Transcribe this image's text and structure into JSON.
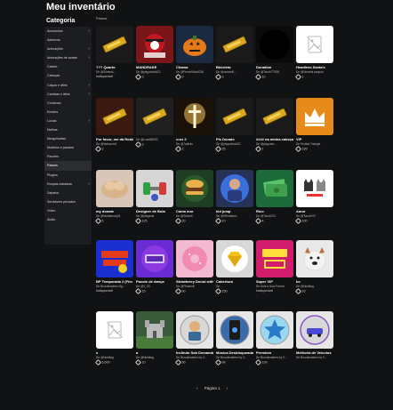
{
  "page": {
    "title": "Meu inventário",
    "category_title": "Categoria",
    "section_label": "Passes",
    "pagination": {
      "prev": "‹",
      "label": "Página 1",
      "next": "›"
    }
  },
  "sidebar": {
    "items": [
      {
        "label": "Acessórios",
        "chevron": true
      },
      {
        "label": "Adesivos",
        "chevron": false
      },
      {
        "label": "Animações",
        "chevron": true
      },
      {
        "label": "Animações de avatar",
        "chevron": true
      },
      {
        "label": "Cabelo",
        "chevron": false
      },
      {
        "label": "Cabeças",
        "chevron": false
      },
      {
        "label": "Calças e afins",
        "chevron": true
      },
      {
        "label": "Camisas e afins",
        "chevron": true
      },
      {
        "label": "Conteúdo",
        "chevron": false
      },
      {
        "label": "Emotes",
        "chevron": false
      },
      {
        "label": "Locais",
        "chevron": true
      },
      {
        "label": "Malhas",
        "chevron": false
      },
      {
        "label": "Mergulhadas",
        "chevron": false
      },
      {
        "label": "Modelos e pacotes",
        "chevron": false
      },
      {
        "label": "Pacotes",
        "chevron": false
      },
      {
        "label": "Passes",
        "chevron": false,
        "active": true
      },
      {
        "label": "Plugins",
        "chevron": false
      },
      {
        "label": "Roupas clássicas",
        "chevron": true
      },
      {
        "label": "Sapatos",
        "chevron": false
      },
      {
        "label": "Servidores privados",
        "chevron": false
      },
      {
        "label": "Vídeo",
        "chevron": false
      },
      {
        "label": "Áudio",
        "chevron": false
      }
    ]
  },
  "items": [
    {
      "name": "??? Quarto",
      "creator": "De @Slimesit...",
      "price": "Indisponível",
      "icon": "gold-bar-icon",
      "bg": "#1a1a1a"
    },
    {
      "name": "MANDRAKE",
      "creator": "De @pisguetodd23",
      "price": "3",
      "icon": "skull-flag-icon",
      "bg": "#7a1518"
    },
    {
      "name": "Chama",
      "creator": "De @FerrariVida2026",
      "price": "9",
      "icon": "pumpkin-icon",
      "bg": "#1b2a40"
    },
    {
      "name": "Bicicleta",
      "creator": "De @zacarelli...",
      "price": "3",
      "icon": "gold-bar-icon",
      "bg": "#1a1a1a"
    },
    {
      "name": "Donation",
      "creator": "De @Tocob779D8",
      "price": "10",
      "icon": "black-circle-icon",
      "bg": "#0a0a0a"
    },
    {
      "name": "Headless Santa's",
      "creator": "De @Nomeal.naopub",
      "price": "1",
      "icon": "placeholder-image-icon",
      "bg": "#ffffff"
    },
    {
      "name": "Por favor, me dá Roblox",
      "creator": "De @Nsfwauto0",
      "price": "2",
      "icon": "gold-bar-icon",
      "bg": "#3a1a10"
    },
    {
      "name": "",
      "creator": "De @LudoB8090",
      "price": "3",
      "icon": "gold-bar-icon",
      "bg": "#202020"
    },
    {
      "name": "cruz 2",
      "creator": "De @7adixilu",
      "price": "2",
      "icon": "cross-light-icon",
      "bg": "#1a1208"
    },
    {
      "name": "Pls Donate",
      "creator": "De @pisguetodd23",
      "price": "25",
      "icon": "gold-bar-icon",
      "bg": "#1a1a1a"
    },
    {
      "name": "#### na minha cabeça cafas",
      "creator": "De @pisgueto...",
      "price": "1",
      "icon": "gold-bar-icon",
      "bg": "#1a1a1a"
    },
    {
      "name": "VIP",
      "creator": "De Textbot Triangle",
      "price": "199",
      "icon": "crown-icon",
      "bg": "#e68a1a"
    },
    {
      "name": "my donate",
      "creator": "De @Nukilaemcj03",
      "price": "5",
      "icon": "bread-icon",
      "bg": "#d8c7b8"
    },
    {
      "name": "Designer de Bola",
      "creator": "De @pistgeria",
      "price": "125",
      "icon": "dumbbell-icon",
      "bg": "#d6d6d6"
    },
    {
      "name": "Cama mor",
      "creator": "De @Silvanit",
      "price": "20",
      "icon": "hamburger-icon",
      "bg": "#1f3d22"
    },
    {
      "name": "kid jump",
      "creator": "De @0Reidstam",
      "price": "10",
      "icon": "kid-photo-icon",
      "bg": "#253358"
    },
    {
      "name": "Rico",
      "creator": "De @Tocob072",
      "price": "4",
      "icon": "money-icon",
      "bg": "#1d6b3a"
    },
    {
      "name": "Amor",
      "creator": "De @Tocob072",
      "price": "100",
      "icon": "cats-icon",
      "bg": "#ffffff"
    },
    {
      "name": "BP Temporada 2 (Fim 04 03/04)",
      "creator": "De Broodmasters Bg...",
      "price": "Indisponível",
      "icon": "bloodpass-icon",
      "bg": "#1a2fd0"
    },
    {
      "name": "Pacote de dança",
      "creator": "De @V_93",
      "price": "15",
      "icon": "dance-pack-icon",
      "bg": "#6a2bd4"
    },
    {
      "name": "Strawberry Donut with...",
      "creator": "De @Ffinabolli",
      "price": "90",
      "icon": "donut-icon",
      "bg": "#f2b9cf"
    },
    {
      "name": "Cabertura",
      "creator": "De ...",
      "price": "150",
      "icon": "diamond-icon",
      "bg": "#d8d8d8"
    },
    {
      "name": "Super VIP",
      "creator": "De Hole a Sua Forrest",
      "price": "Indisponível",
      "icon": "super-vip-icon",
      "bg": "#d21c6c"
    },
    {
      "name": "bc",
      "creator": "De @Nukiltag",
      "price": "20",
      "icon": "dog-icon",
      "bg": "#e9e9e9"
    },
    {
      "name": "s",
      "creator": "De @Nukiltag",
      "price": "5,000",
      "icon": "placeholder-image-icon",
      "bg": "#ffffff"
    },
    {
      "name": "a",
      "creator": "De @Nukiltag",
      "price": "10",
      "icon": "castle-icon",
      "bg": "#3a5a3a"
    },
    {
      "name": "Inclindo Sob Demanda",
      "creator": "De Broodmasters by V...",
      "price": "50",
      "icon": "character-badge-icon",
      "bg": "#e6e6e6"
    },
    {
      "name": "Música Desbloqueada",
      "creator": "De Broodmasters by V...",
      "price": "99",
      "icon": "music-phone-icon",
      "bg": "#e6e6e6"
    },
    {
      "name": "Premium",
      "creator": "De Broodmasters by V...",
      "price": "199",
      "icon": "star-badge-icon",
      "bg": "#e6e6e6"
    },
    {
      "name": "Melhoria de Veículos",
      "creator": "De Broodmasters by V...",
      "price": "",
      "icon": "vehicle-badge-icon",
      "bg": "#e6e6e6"
    }
  ]
}
